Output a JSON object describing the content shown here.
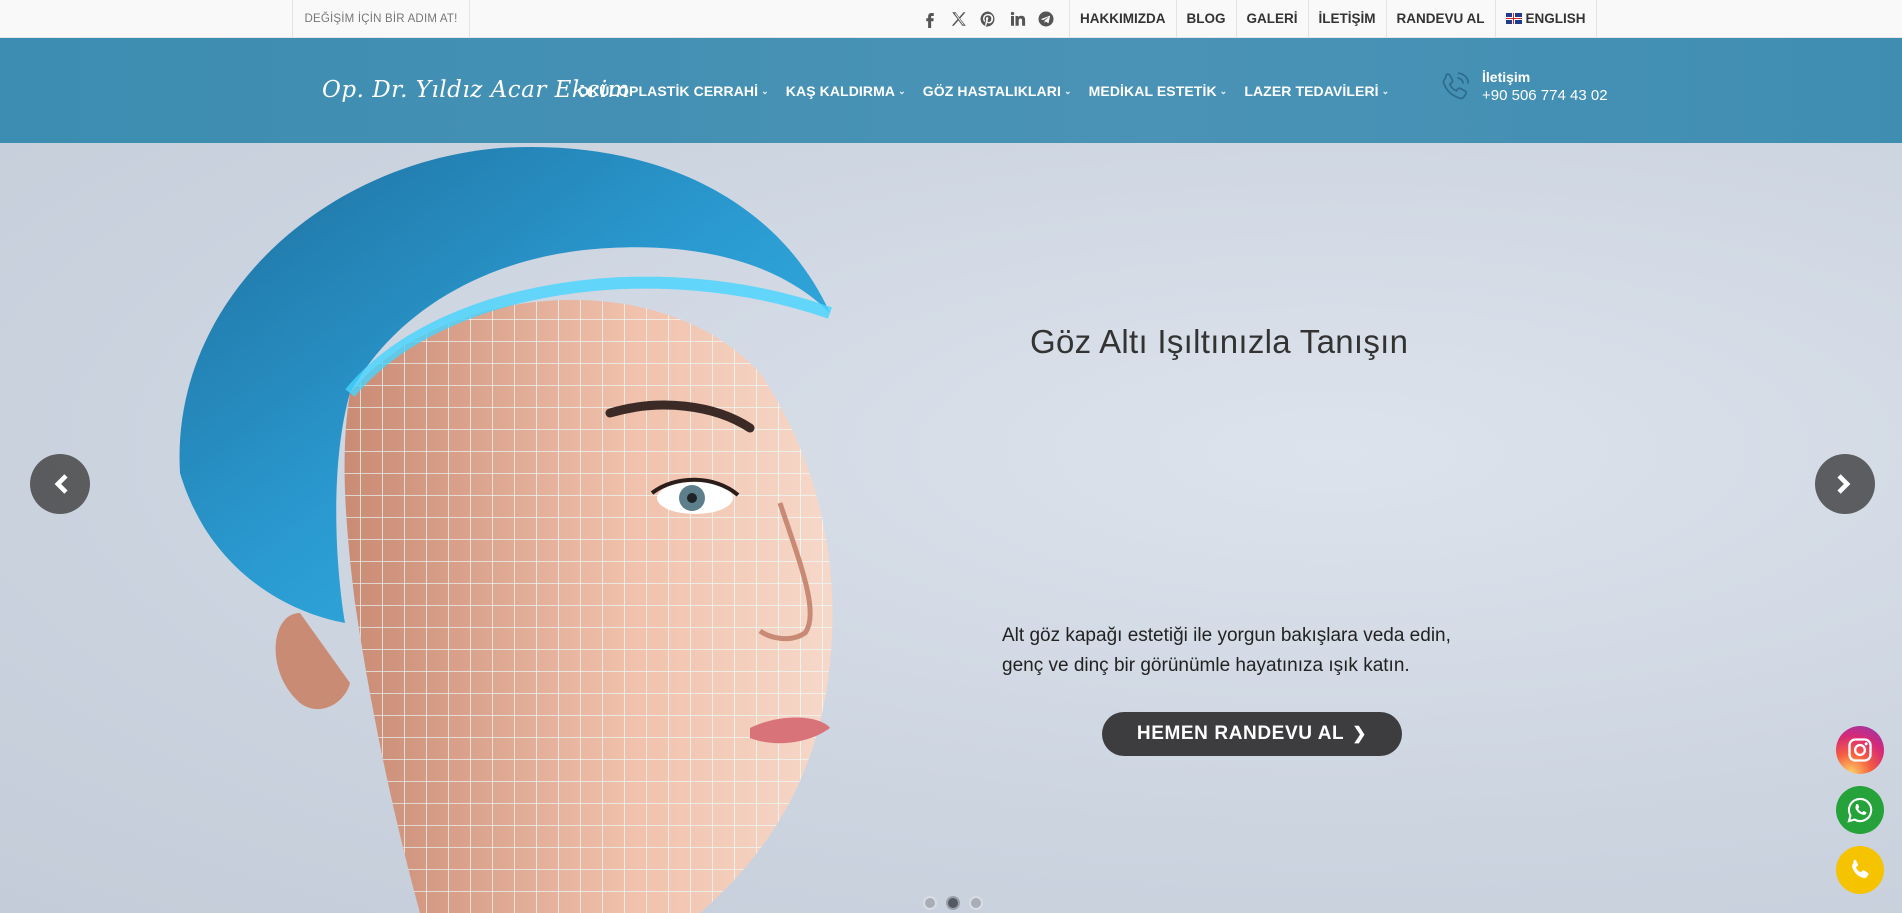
{
  "topbar": {
    "slogan": "DEĞİŞİM İÇİN BİR ADIM AT!",
    "socials": [
      {
        "icon": "facebook-icon"
      },
      {
        "icon": "x-twitter-icon"
      },
      {
        "icon": "pinterest-icon"
      },
      {
        "icon": "linkedin-icon"
      },
      {
        "icon": "telegram-icon"
      }
    ],
    "links": {
      "about": "HAKKIMIZDA",
      "blog": "BLOG",
      "gallery": "GALERİ",
      "contact": "İLETİŞİM",
      "appointment": "RANDEVU AL",
      "language": "ENGLISH"
    }
  },
  "header": {
    "logo_text": "Op. Dr. Yıldız Acar Ekcim",
    "nav": {
      "oculoplastic": "OKÜLOPLASTİK CERRAHİ",
      "brow_lift": "KAŞ KALDIRMA",
      "eye_diseases": "GÖZ HASTALIKLARI",
      "medical_aesthetic": "MEDİKAL ESTETİK",
      "laser": "LAZER TEDAVİLERİ"
    },
    "contact": {
      "title": "İletişim",
      "phone": "+90 506 774 43 02"
    }
  },
  "hero": {
    "title": "Göz Altı Işıltınızla Tanışın",
    "text_line1": "Alt göz kapağı estetiği ile yorgun bakışlara veda edin,",
    "text_line2": "genç ve dinç bir görünümle hayatınıza ışık katın.",
    "cta": "HEMEN RANDEVU AL",
    "active_slide": 2,
    "slide_count": 3
  },
  "colors": {
    "header_blue": "#4a93b6",
    "cta_dark": "#3d3d3f",
    "whatsapp_green": "#25a23a",
    "phone_yellow": "#f6c300"
  }
}
